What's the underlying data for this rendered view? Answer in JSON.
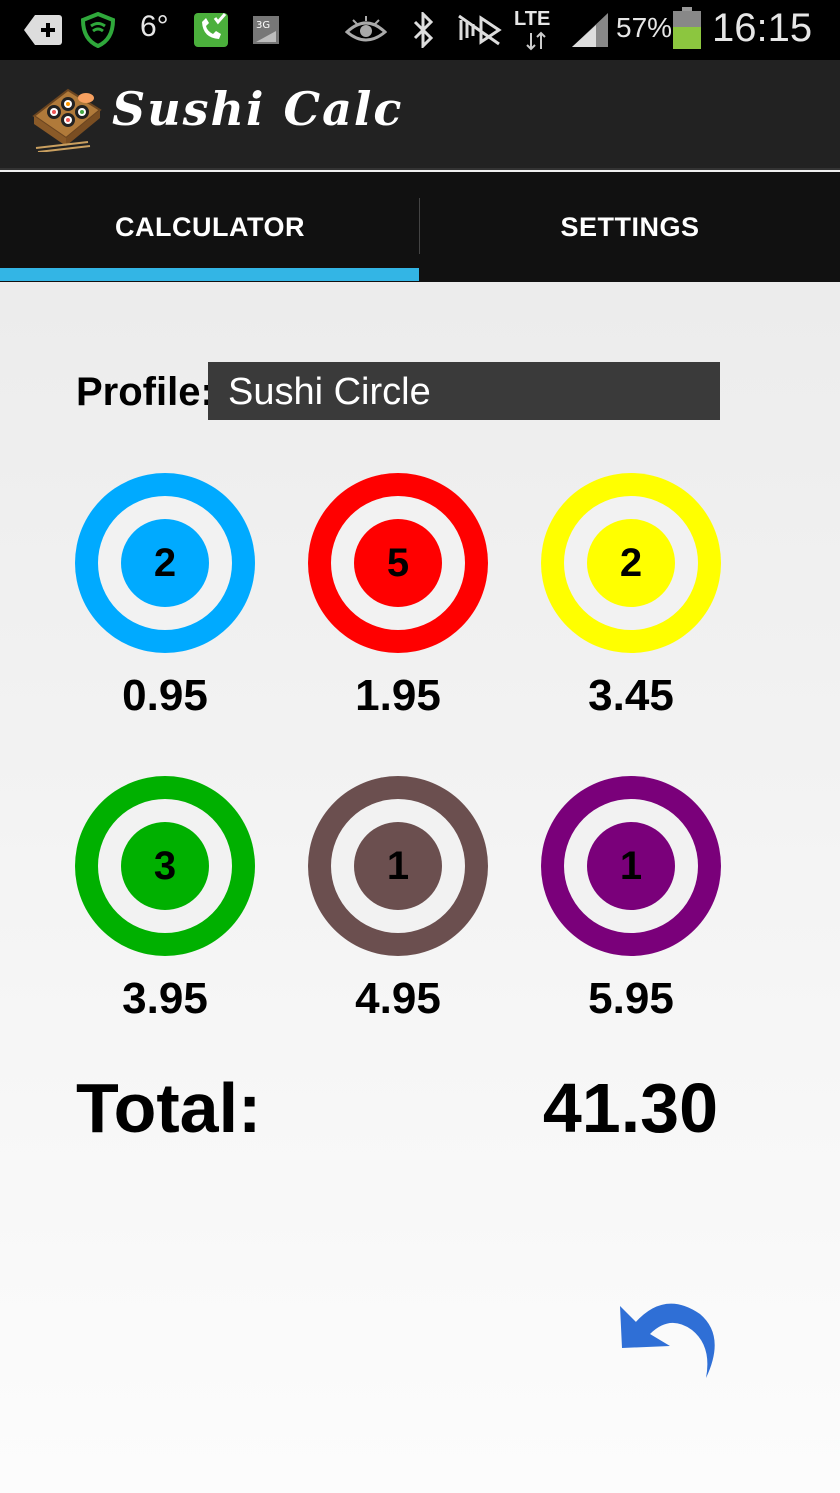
{
  "status_bar": {
    "temperature": "6°",
    "network": "LTE",
    "battery_percent": "57%",
    "battery_level": 0.57,
    "time": "16:15",
    "icons": [
      "add-icon",
      "shield-icon",
      "phone-check-icon",
      "3g-icon",
      "eye-icon",
      "bluetooth-icon",
      "mute-icon",
      "lte-icon",
      "signal-icon",
      "battery-icon"
    ]
  },
  "app": {
    "title": "Sushi Calc"
  },
  "tabs": [
    {
      "label": "CALCULATOR",
      "selected": true
    },
    {
      "label": "SETTINGS",
      "selected": false
    }
  ],
  "profile": {
    "label": "Profile:",
    "value": "Sushi Circle"
  },
  "plates": [
    {
      "color": "#00aaff",
      "count": "2",
      "price": "0.95"
    },
    {
      "color": "#ff0000",
      "count": "5",
      "price": "1.95"
    },
    {
      "color": "#ffff00",
      "count": "2",
      "price": "3.45"
    },
    {
      "color": "#00b000",
      "count": "3",
      "price": "3.95"
    },
    {
      "color": "#6b4f4f",
      "count": "1",
      "price": "4.95"
    },
    {
      "color": "#7a007a",
      "count": "1",
      "price": "5.95"
    }
  ],
  "total": {
    "label": "Total:",
    "value": "41.30"
  },
  "colors": {
    "tab_indicator": "#33b5e5",
    "undo": "#2f6fd6"
  }
}
